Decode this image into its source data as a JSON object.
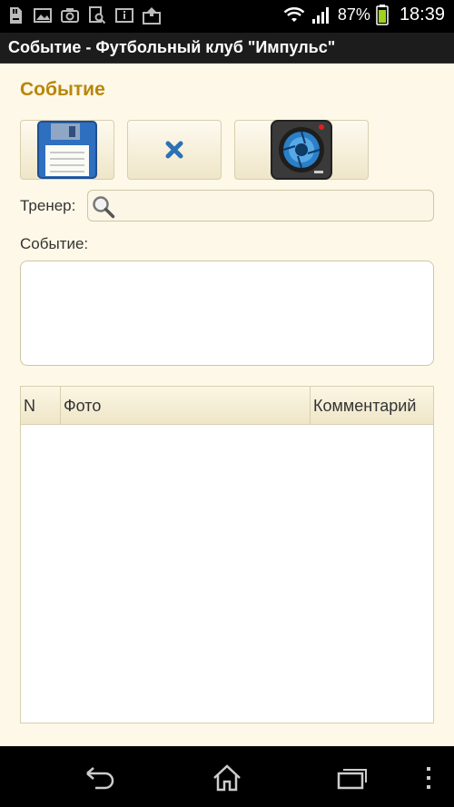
{
  "status_bar": {
    "notification_icons": [
      "sd-card-icon",
      "image-icon",
      "camera-icon",
      "search-file-icon",
      "info-icon",
      "upload-icon"
    ],
    "battery_percent": "87%",
    "time": "18:39"
  },
  "window": {
    "title": "Событие - Футбольный клуб \"Импульс\""
  },
  "form": {
    "title": "Событие",
    "toolbar": {
      "save_icon": "floppy-disk-icon",
      "delete_icon": "close-icon",
      "photo_icon": "camera-icon"
    },
    "trainer_label": "Тренер:",
    "trainer_value": "",
    "event_label": "Событие:",
    "event_value": ""
  },
  "table": {
    "columns": [
      "N",
      "Фото",
      "Комментарий"
    ],
    "rows": []
  },
  "nav_bar": {
    "buttons": [
      "back-icon",
      "home-icon",
      "recent-apps-icon",
      "menu-icon"
    ]
  },
  "colors": {
    "accent": "#b8860b",
    "background": "#fdf8e7",
    "icon_blue": "#2b72b5"
  }
}
